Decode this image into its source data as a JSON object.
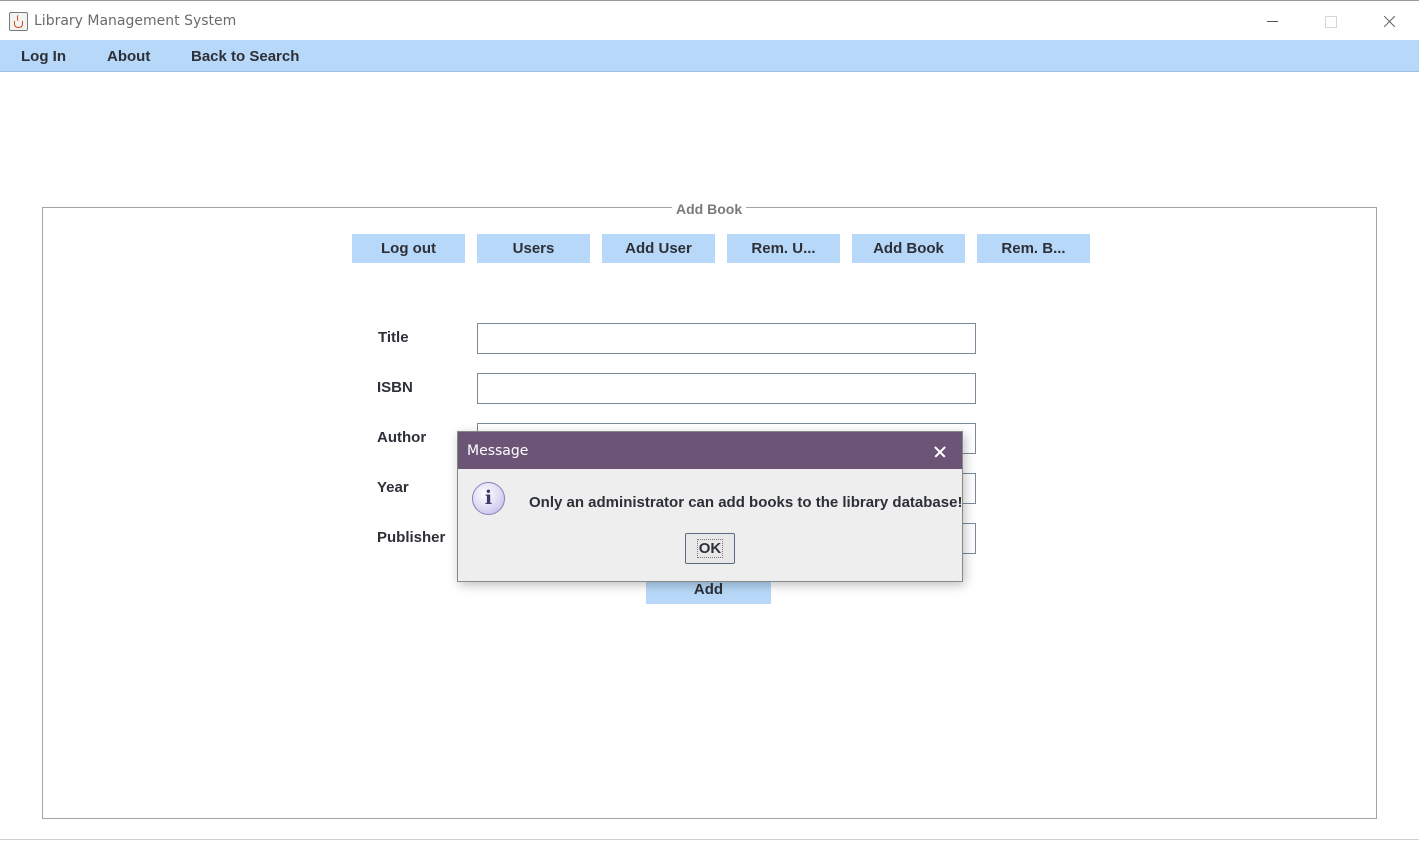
{
  "window": {
    "title": "Library Management System"
  },
  "menubar": {
    "items": [
      "Log In",
      "About",
      "Back to Search"
    ]
  },
  "panel": {
    "title": "Add Book",
    "toolbar": [
      "Log out",
      "Users",
      "Add User",
      "Rem. U...",
      "Add Book",
      "Rem. B..."
    ],
    "fields": [
      {
        "label": "Title",
        "value": ""
      },
      {
        "label": "ISBN",
        "value": ""
      },
      {
        "label": "Author",
        "value": ""
      },
      {
        "label": "Year",
        "value": ""
      },
      {
        "label": "Publisher",
        "value": ""
      }
    ],
    "add_label": "Add"
  },
  "dialog": {
    "title": "Message",
    "icon": "info-icon",
    "message": "Only an administrator can add books to the library database!",
    "ok_label": "OK"
  }
}
